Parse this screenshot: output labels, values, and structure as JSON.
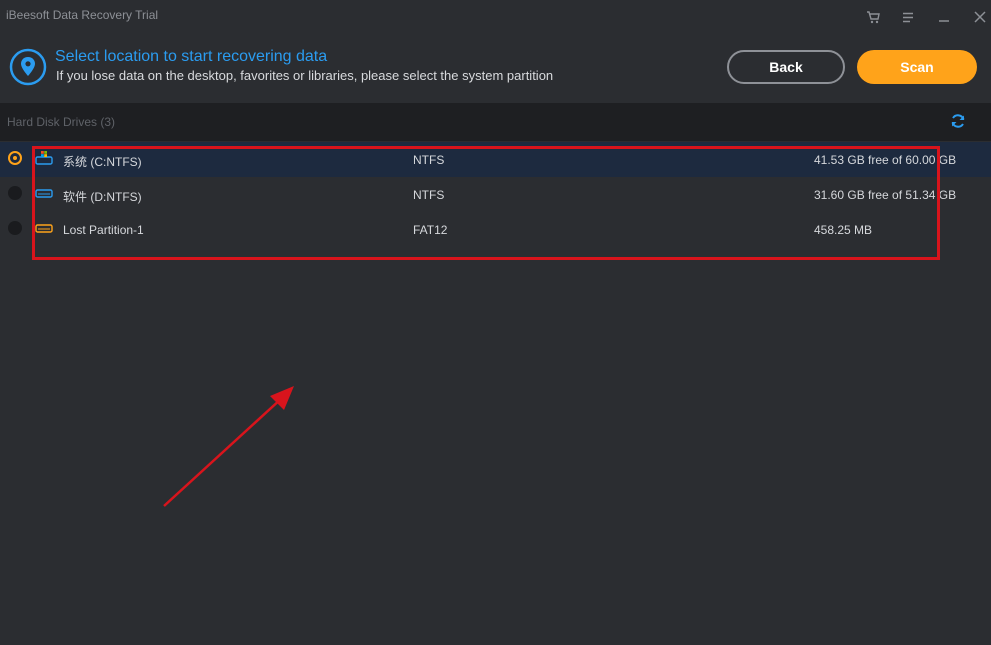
{
  "app": {
    "title": "iBeesoft Data Recovery Trial"
  },
  "window_controls": {
    "cart_icon": "cart-icon",
    "menu_icon": "menu-icon",
    "minimize_icon": "minimize-icon",
    "close_icon": "close-icon"
  },
  "header": {
    "title": "Select location to start recovering data",
    "subtitle": "If you lose data on the desktop, favorites or libraries, please select the system partition",
    "back_label": "Back",
    "scan_label": "Scan"
  },
  "section": {
    "label": "Hard Disk Drives (3)"
  },
  "drives": [
    {
      "name": "系统 (C:NTFS)",
      "fs": "NTFS",
      "size": "41.53 GB free of 60.00 GB",
      "selected": true,
      "icon": "windows-drive-icon"
    },
    {
      "name": "软件 (D:NTFS)",
      "fs": "NTFS",
      "size": "31.60 GB free of 51.34 GB",
      "selected": false,
      "icon": "drive-icon"
    },
    {
      "name": "Lost Partition-1",
      "fs": "FAT12",
      "size": "458.25 MB",
      "selected": false,
      "icon": "lost-drive-icon"
    }
  ],
  "colors": {
    "accent": "#2b9cf0",
    "scan_button": "#ffa31a",
    "annotation": "#d8141c",
    "selected_row": "#1d2a3f"
  }
}
